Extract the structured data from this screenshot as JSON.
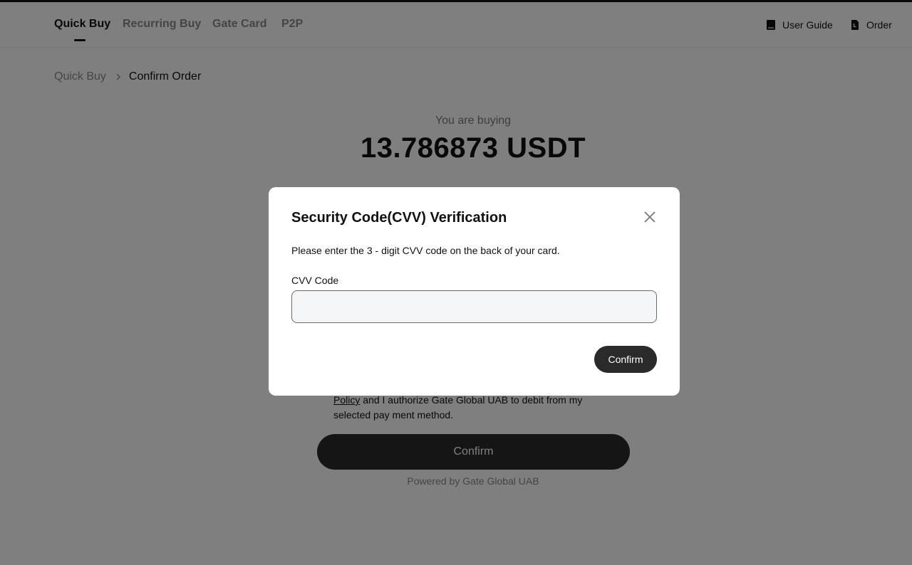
{
  "nav": {
    "tabs": [
      {
        "label": "Quick Buy",
        "active": true
      },
      {
        "label": "Recurring Buy",
        "active": false
      },
      {
        "label": "Gate Card",
        "active": false
      },
      {
        "label": "P2P",
        "active": false
      }
    ],
    "user_guide_label": "User Guide",
    "order_label": "Order"
  },
  "breadcrumb": {
    "home": "Quick Buy",
    "current": "Confirm Order"
  },
  "order": {
    "buying_label": "You are buying",
    "amount": "13.786873 USDT"
  },
  "consent": {
    "policy_link": "Policy",
    "text": " and I authorize Gate Global UAB to debit from my selected pay ment method."
  },
  "main_confirm_label": "Confirm",
  "powered_by": "Powered by Gate Global UAB",
  "modal": {
    "title": "Security Code(CVV) Verification",
    "description": "Please enter the 3 - digit CVV code on the back of your card.",
    "field_label": "CVV Code",
    "field_value": "",
    "confirm_label": "Confirm"
  },
  "colors": {
    "overlay": "rgba(0,0,0,0.5)",
    "button_dark": "#2a2a2a",
    "muted_text": "#8a8a8a"
  }
}
